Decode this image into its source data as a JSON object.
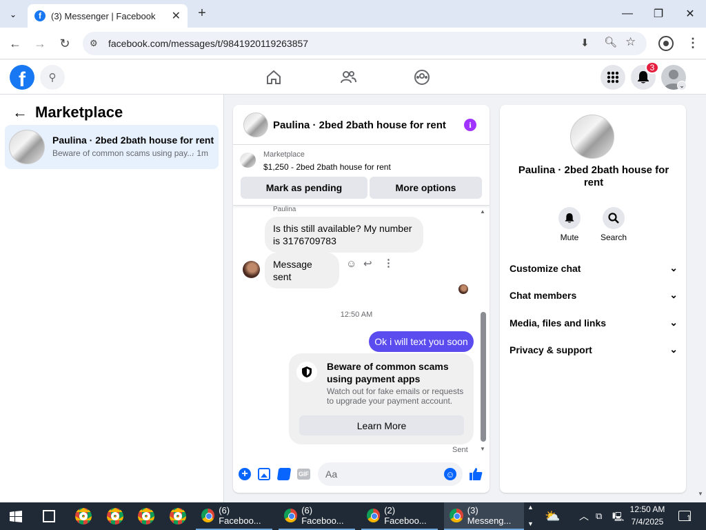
{
  "browser": {
    "tab_title": "(3) Messenger | Facebook",
    "url": "facebook.com/messages/t/9841920119263857",
    "new_tab_icon": "plus-icon"
  },
  "header": {
    "notification_count": "3"
  },
  "left": {
    "title": "Marketplace",
    "conversations": [
      {
        "name": "Paulina · 2bed 2bath house for rent",
        "preview": "Beware of common scams using pay...",
        "time": "· 1m"
      }
    ]
  },
  "chat": {
    "title": "Paulina · 2bed 2bath house for rent",
    "listing": {
      "label": "Marketplace",
      "price_title": "$1,250 - 2bed 2bath house for rent"
    },
    "buttons": {
      "pending": "Mark as pending",
      "more": "More options"
    },
    "messages": {
      "sender": "Paulina",
      "incoming_1": "Is this still available? My number is 3176709783",
      "incoming_2": "Message sent",
      "timestamp": "12:50 AM",
      "outgoing": "Ok i will text you soon",
      "notice_title": "Beware of common scams using payment apps",
      "notice_body": "Watch out for fake emails or requests to upgrade your payment account.",
      "notice_button": "Learn More",
      "status": "Sent"
    },
    "composer": {
      "placeholder": "Aa",
      "gif": "GIF"
    }
  },
  "right": {
    "name": "Paulina · 2bed 2bath house for rent",
    "mute": "Mute",
    "search": "Search",
    "sections": [
      "Customize chat",
      "Chat members",
      "Media, files and links",
      "Privacy & support"
    ]
  },
  "taskbar": {
    "tasks": [
      "(6) Faceboo...",
      "(6) Faceboo...",
      "(2) Faceboo...",
      "(3) Messeng..."
    ],
    "time": "12:50 AM",
    "date": "7/4/2025",
    "notif": "1"
  },
  "colors": {
    "fb_blue": "#1877f2",
    "messenger_purple": "#a033ff",
    "outgoing_bubble": "#5b4cf0"
  }
}
